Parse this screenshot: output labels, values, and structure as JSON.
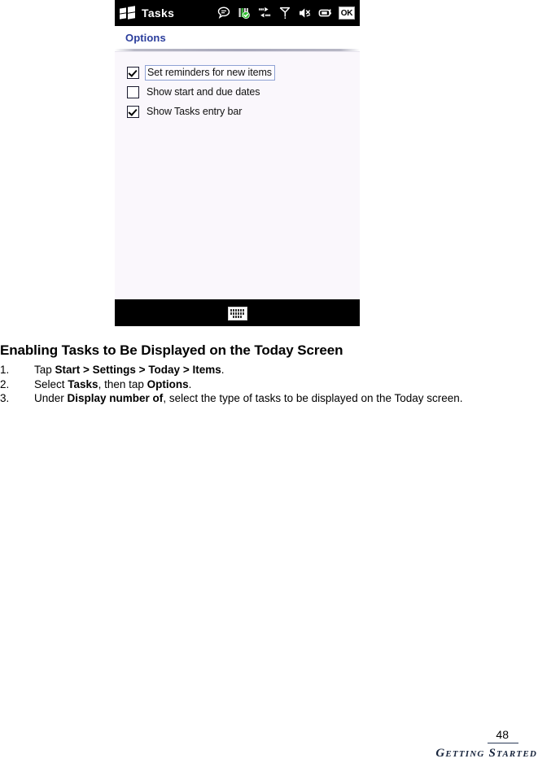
{
  "device": {
    "titlebar": {
      "start_icon": "windows-flag-icon",
      "app_title": "Tasks",
      "tray_icons": [
        {
          "name": "messaging-icon",
          "label": "Messaging"
        },
        {
          "name": "signal-strength-connected-icon",
          "label": "Connected"
        },
        {
          "name": "activesync-icon",
          "label": "ActiveSync"
        },
        {
          "name": "phone-signal-icon",
          "label": "Phone signal"
        },
        {
          "name": "volume-icon",
          "label": "Volume"
        },
        {
          "name": "battery-icon",
          "label": "Battery"
        }
      ],
      "ok_label": "OK"
    },
    "page_header": "Options",
    "options": [
      {
        "label": "Set reminders for new items",
        "checked": true,
        "focused": true
      },
      {
        "label": "Show start and due dates",
        "checked": false,
        "focused": false
      },
      {
        "label": "Show Tasks entry bar",
        "checked": true,
        "focused": false
      }
    ],
    "sip": {
      "icon": "keyboard-icon"
    }
  },
  "document": {
    "section_title": "Enabling Tasks to Be Displayed on the Today Screen",
    "steps": [
      {
        "number": "1.",
        "parts": [
          {
            "text": "Tap ",
            "bold": false
          },
          {
            "text": "Start > Settings > Today > Items",
            "bold": true
          },
          {
            "text": ".",
            "bold": false
          }
        ]
      },
      {
        "number": "2.",
        "parts": [
          {
            "text": "Select ",
            "bold": false
          },
          {
            "text": "Tasks",
            "bold": true
          },
          {
            "text": ", then tap ",
            "bold": false
          },
          {
            "text": "Options",
            "bold": true
          },
          {
            "text": ".",
            "bold": false
          }
        ]
      },
      {
        "number": "3.",
        "parts": [
          {
            "text": "Under ",
            "bold": false
          },
          {
            "text": "Display number of",
            "bold": true
          },
          {
            "text": ", select the type of tasks to be displayed on the Today screen.",
            "bold": false
          }
        ]
      }
    ]
  },
  "footer": {
    "page_number": "48",
    "running_head": "Getting Started"
  },
  "colors": {
    "header_blue": "#2a3d9c",
    "screen_bg": "#faf7fc",
    "titlebar_bg": "#000000",
    "footer_navy": "#17243c",
    "focus_outline": "#8fa2d4"
  }
}
